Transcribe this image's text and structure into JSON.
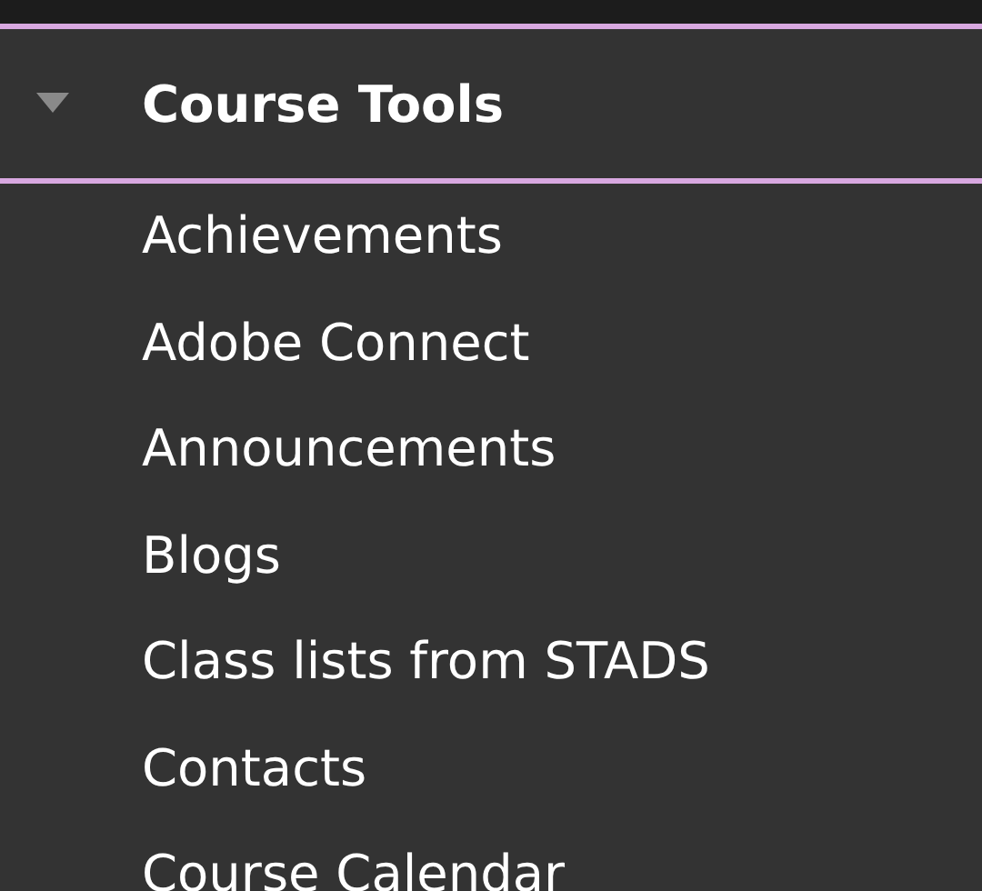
{
  "section": {
    "title": "Course Tools",
    "expanded": true
  },
  "items": [
    {
      "label": "Achievements"
    },
    {
      "label": "Adobe Connect"
    },
    {
      "label": "Announcements"
    },
    {
      "label": "Blogs"
    },
    {
      "label": "Class lists from STADS"
    },
    {
      "label": "Contacts"
    },
    {
      "label": "Course Calendar"
    }
  ]
}
